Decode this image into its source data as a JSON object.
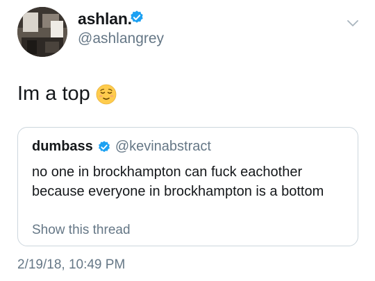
{
  "author": {
    "display_name": "ashlan.",
    "handle": "@ashlangrey",
    "verified": true,
    "avatar_icon": "profile-photo"
  },
  "tweet": {
    "text": "Im a top",
    "emoji_icon": "relieved-face-emoji",
    "timestamp": "2/19/18, 10:49 PM"
  },
  "quoted_tweet": {
    "display_name": "dumbass",
    "handle": "@kevinabstract",
    "verified": true,
    "text": "no one in brockhampton can fuck eachother because everyone in brockhampton is a bottom",
    "show_thread_label": "Show this thread"
  },
  "colors": {
    "verified_blue": "#1da1f2",
    "secondary_text": "#657786",
    "border": "#ccd6dd"
  }
}
